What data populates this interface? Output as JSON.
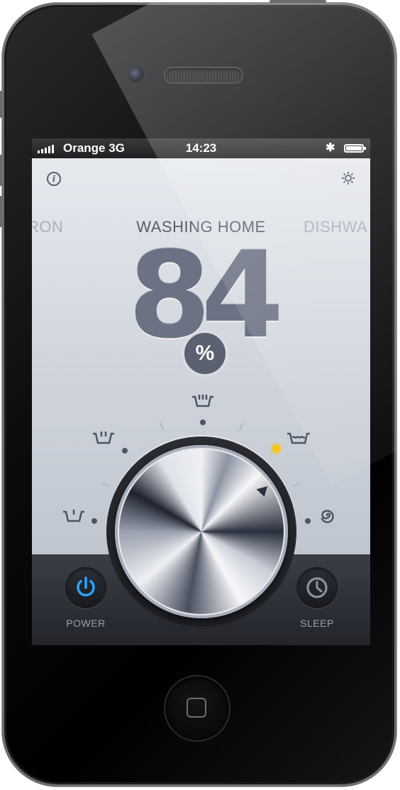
{
  "status_bar": {
    "carrier": "Orange 3G",
    "time": "14:23"
  },
  "modes": {
    "previous": "RON",
    "current": "WASHING HOME",
    "next": "DISHWA"
  },
  "level": {
    "value": "84",
    "unit": "%"
  },
  "programs": [
    "hand-wash",
    "quick-wash",
    "intensive-wash",
    "soak-wash",
    "spiral-dry"
  ],
  "active_program": "soak-wash",
  "buttons": {
    "power_label": "POWER",
    "sleep_label": "SLEEP"
  },
  "colors": {
    "accent_blue": "#2ea2ff",
    "active_dot": "#f7c418",
    "numeral": "#6b7283"
  }
}
